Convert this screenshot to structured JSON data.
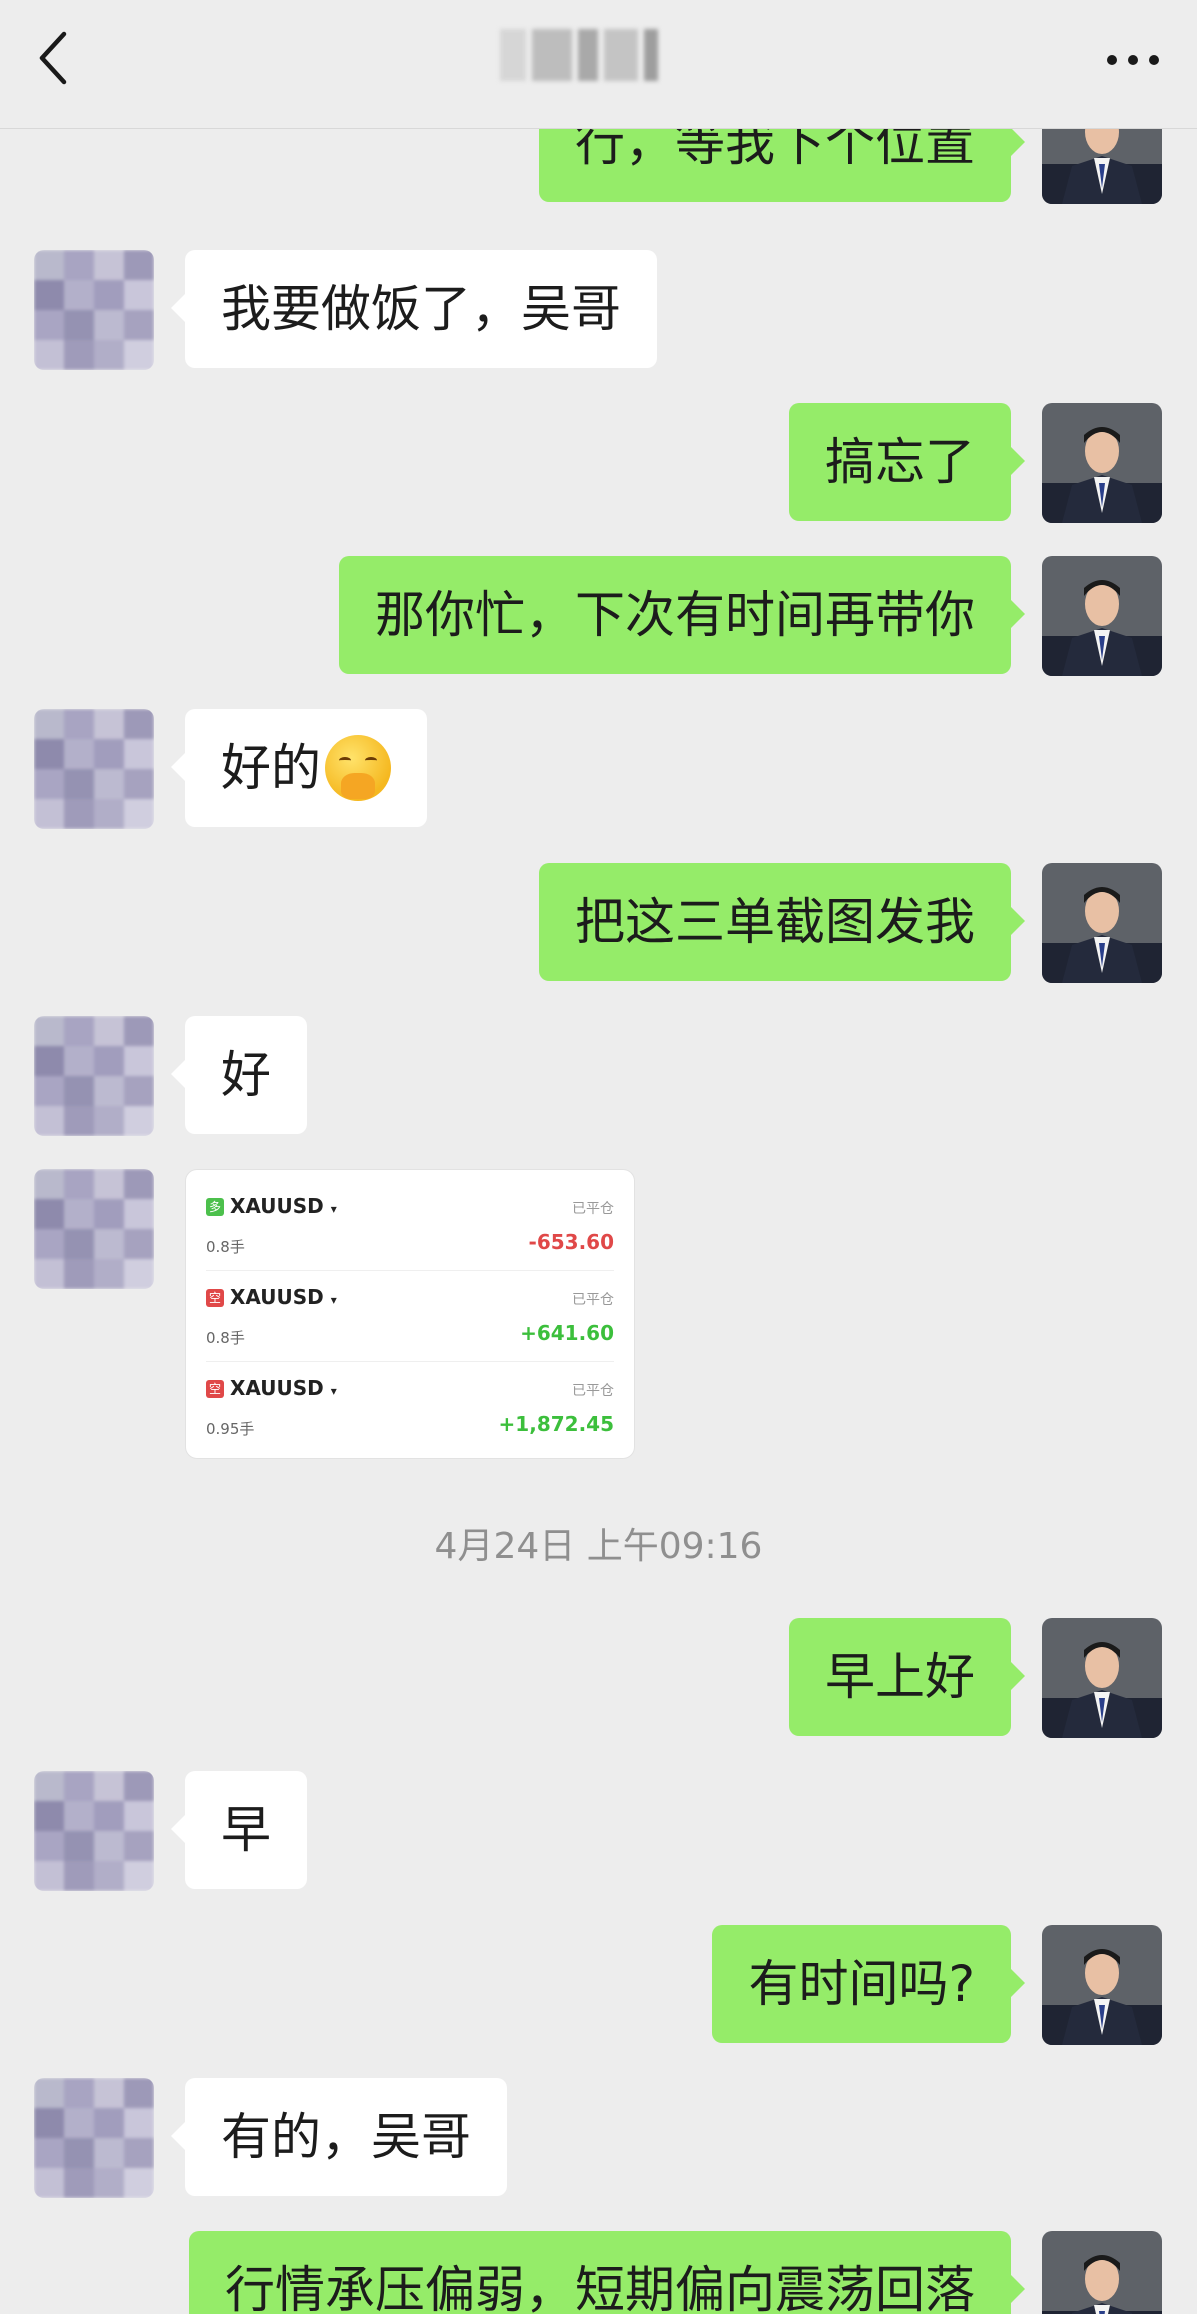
{
  "header": {
    "back_icon": "chevron-left-icon",
    "contact_name_obscured": "",
    "more_icon": "more-horizontal-icon"
  },
  "messages": [
    {
      "side": "out",
      "text": "行，等我下个位置"
    },
    {
      "side": "in",
      "text": "我要做饭了，吴哥"
    },
    {
      "side": "out",
      "text": "搞忘了"
    },
    {
      "side": "out",
      "text": "那你忙，下次有时间再带你"
    },
    {
      "side": "in",
      "text": "好的",
      "emoji": "shushing-face-emoji"
    },
    {
      "side": "out",
      "text": "把这三单截图发我"
    },
    {
      "side": "in",
      "text": "好"
    },
    {
      "side": "out",
      "text": "早上好"
    },
    {
      "side": "in",
      "text": "早"
    },
    {
      "side": "out",
      "text": "有时间吗?"
    },
    {
      "side": "in",
      "text": "有的，吴哥"
    },
    {
      "side": "out",
      "text": "行情承压偏弱，短期偏向震荡回落"
    }
  ],
  "trade_card": {
    "trades": [
      {
        "badge": "多",
        "badge_color": "#4cc04c",
        "symbol": "XAUUSD",
        "lots": "0.8手",
        "status": "已平仓",
        "pl": "-653.60",
        "pl_color": "#e04848"
      },
      {
        "badge": "空",
        "badge_color": "#e04848",
        "symbol": "XAUUSD",
        "lots": "0.8手",
        "status": "已平仓",
        "pl": "+641.60",
        "pl_color": "#3cbf3c"
      },
      {
        "badge": "空",
        "badge_color": "#e04848",
        "symbol": "XAUUSD",
        "lots": "0.95手",
        "status": "已平仓",
        "pl": "+1,872.45",
        "pl_color": "#3cbf3c"
      }
    ]
  },
  "timestamp": "4月24日 上午09:16",
  "colors": {
    "background": "#ededed",
    "bubble_out": "#95ec69",
    "bubble_in": "#ffffff"
  }
}
